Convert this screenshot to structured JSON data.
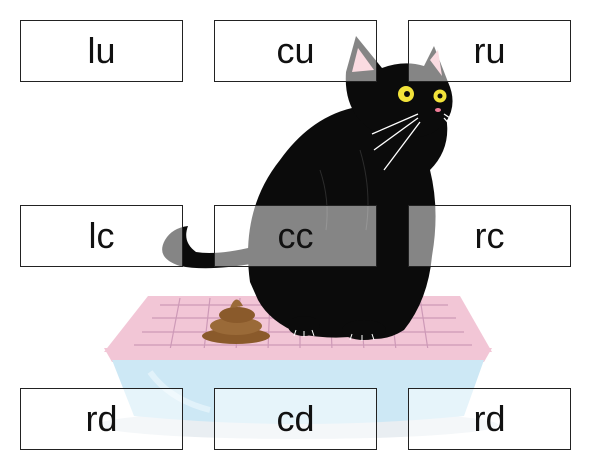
{
  "grid": {
    "lu": "lu",
    "cu": "cu",
    "ru": "ru",
    "lc": "lc",
    "cc": "cc",
    "rc": "rc",
    "ld": "rd",
    "cd": "cd",
    "rd": "rd"
  },
  "colors": {
    "cat": "#0b0b0b",
    "eye": "#f2e33a",
    "ear_inner": "#f4b6c2",
    "nose": "#f07c98",
    "litter_box_rim": "#f2c6d6",
    "litter_box_tray": "#cde8f5",
    "litter_grid": "#c58fb0",
    "poop": "#8a5a2b",
    "shadow": "#e9eef2"
  }
}
